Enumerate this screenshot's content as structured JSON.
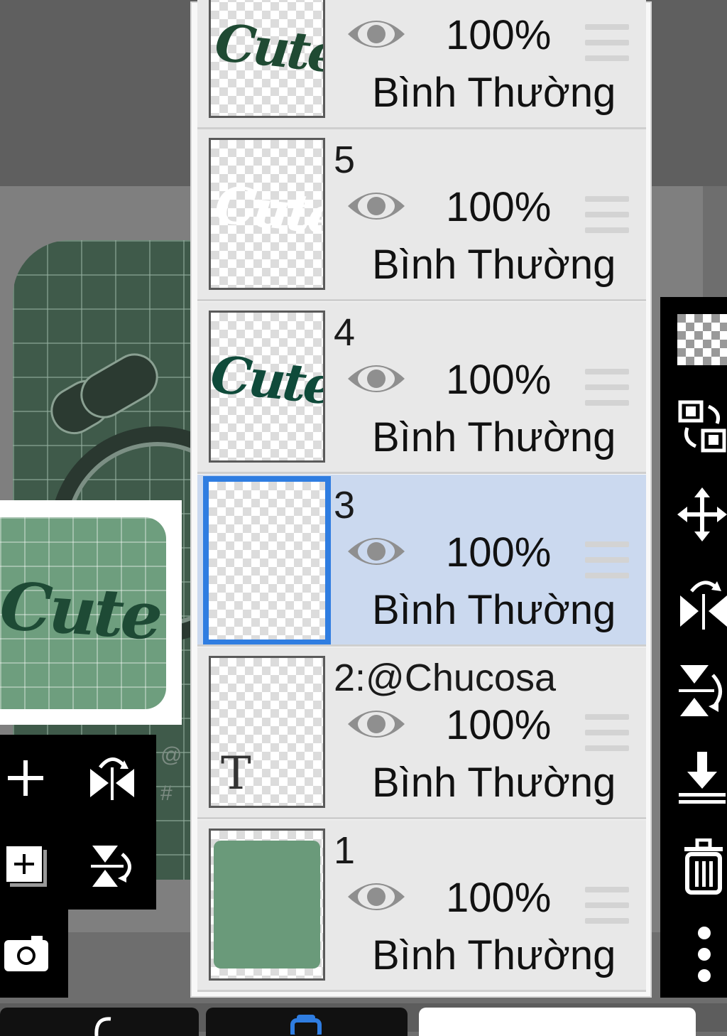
{
  "canvas": {
    "preview_text": "Cute",
    "side_marks": [
      "@",
      "#"
    ]
  },
  "layers": [
    {
      "name": "",
      "opacity": "100%",
      "blend_mode": "Bình Thường",
      "thumb": "cute-dark",
      "selected": false
    },
    {
      "name": "5",
      "opacity": "100%",
      "blend_mode": "Bình Thường",
      "thumb": "cute-white",
      "selected": false
    },
    {
      "name": "4",
      "opacity": "100%",
      "blend_mode": "Bình Thường",
      "thumb": "cute-dark",
      "selected": false
    },
    {
      "name": "3",
      "opacity": "100%",
      "blend_mode": "Bình Thường",
      "thumb": "empty",
      "selected": true
    },
    {
      "name": "2:@Chucosa",
      "opacity": "100%",
      "blend_mode": "Bình Thường",
      "thumb": "text",
      "selected": false
    },
    {
      "name": "1",
      "opacity": "100%",
      "blend_mode": "Bình Thường",
      "thumb": "green-fill",
      "selected": false
    }
  ],
  "thumb_text": {
    "cute": "Cute",
    "text_T": "T"
  },
  "colors": {
    "selection": "#2f7de1",
    "selected_row": "#cbd9ef",
    "canvas_green": "#6e9e7e",
    "ink_green": "#1e4a35"
  },
  "icons": {
    "left_toolbar": [
      "plus-icon",
      "flip-horizontal-icon",
      "add-layer-icon",
      "flip-vertical-icon",
      "camera-icon"
    ],
    "right_toolbar": [
      "transparent-layer-icon",
      "swap-layers-icon",
      "move-icon",
      "flip-horizontal-icon",
      "flip-vertical-icon",
      "merge-down-icon",
      "trash-icon",
      "more-vertical-icon"
    ],
    "eye": "eye-icon",
    "handle": "drag-handle-icon"
  }
}
